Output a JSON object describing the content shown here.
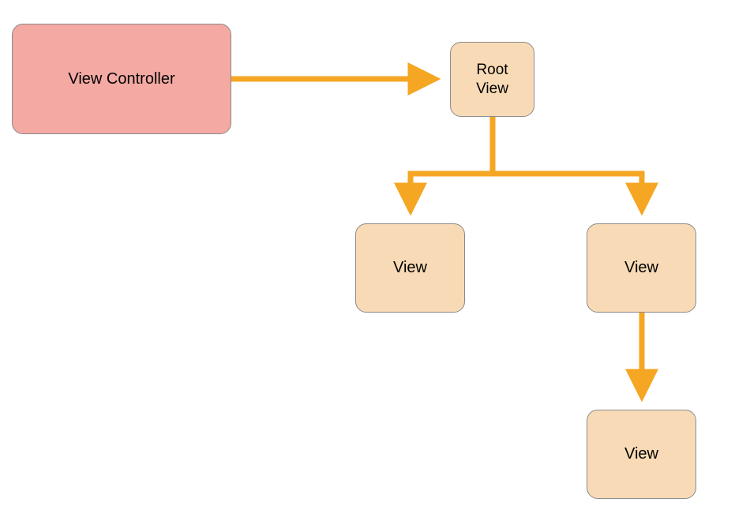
{
  "diagram": {
    "nodes": {
      "controller": {
        "label": "View Controller"
      },
      "root": {
        "label_line1": "Root",
        "label_line2": "View"
      },
      "left_child": {
        "label": "View"
      },
      "right_child": {
        "label": "View"
      },
      "grandchild": {
        "label": "View"
      }
    },
    "colors": {
      "controller_bg": "#f4a9a3",
      "view_bg": "#f8dbb6",
      "arrow": "#f5a623",
      "border": "#8a8a8a"
    },
    "edges": [
      {
        "from": "controller",
        "to": "root"
      },
      {
        "from": "root",
        "to": "left_child"
      },
      {
        "from": "root",
        "to": "right_child"
      },
      {
        "from": "right_child",
        "to": "grandchild"
      }
    ]
  }
}
